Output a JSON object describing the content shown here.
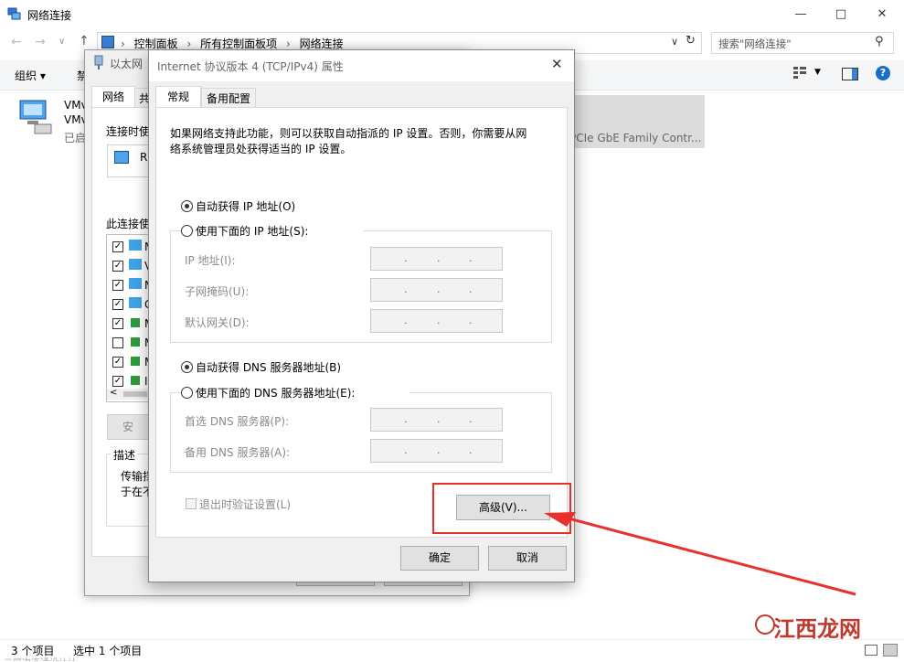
{
  "explorer": {
    "title": "网络连接",
    "breadcrumb": [
      "控制面板",
      "所有控制面板项",
      "网络连接"
    ],
    "search_placeholder": "搜索\"网络连接\"",
    "toolbar": {
      "organize": "组织 ▾",
      "partial": "禁"
    },
    "adapter": {
      "name1": "VMv",
      "name2": "VMv",
      "status": "已启",
      "driver": "PCIe GbE Family Contr..."
    },
    "status": {
      "count": "3 个项目",
      "selected": "选中 1 个项目",
      "cut_text": "二层次连通设计计"
    }
  },
  "eth_dialog": {
    "title": "以太网",
    "tab_network": "网络",
    "tab_share": "共",
    "connect_using": "连接时使",
    "adapter_label": "R",
    "items_label": "此连接使",
    "items": [
      {
        "checked": true,
        "text": "M"
      },
      {
        "checked": true,
        "text": "V"
      },
      {
        "checked": true,
        "text": "M"
      },
      {
        "checked": true,
        "text": "G"
      },
      {
        "checked": true,
        "text": "M"
      },
      {
        "checked": false,
        "text": "M"
      },
      {
        "checked": true,
        "text": "M"
      },
      {
        "checked": true,
        "text": "I"
      }
    ],
    "install_btn": "安",
    "desc_label": "描述",
    "desc_line1": "传输挡",
    "desc_line2": "于在不"
  },
  "ipv4_dialog": {
    "title": "Internet 协议版本 4 (TCP/IPv4) 属性",
    "tab_general": "常规",
    "tab_alternate": "备用配置",
    "intro_line1": "如果网络支持此功能，则可以获取自动指派的 IP 设置。否则，你需要从网",
    "intro_line2": "络系统管理员处获得适当的 IP 设置。",
    "radio_auto_ip": "自动获得 IP 地址(O)",
    "radio_manual_ip": "使用下面的 IP 地址(S):",
    "ip_label": "IP 地址(I):",
    "mask_label": "子网掩码(U):",
    "gateway_label": "默认网关(D):",
    "radio_auto_dns": "自动获得 DNS 服务器地址(B)",
    "radio_manual_dns": "使用下面的 DNS 服务器地址(E):",
    "dns1_label": "首选 DNS 服务器(P):",
    "dns2_label": "备用 DNS 服务器(A):",
    "validate_label": "退出时验证设置(L)",
    "advanced_btn": "高级(V)...",
    "ok_btn": "确定",
    "cancel_btn": "取消",
    "ip_dots": "."
  },
  "watermark": {
    "text": "江西龙网"
  },
  "colors": {
    "highlight": "#e8312a",
    "accent": "#0a66c2"
  }
}
